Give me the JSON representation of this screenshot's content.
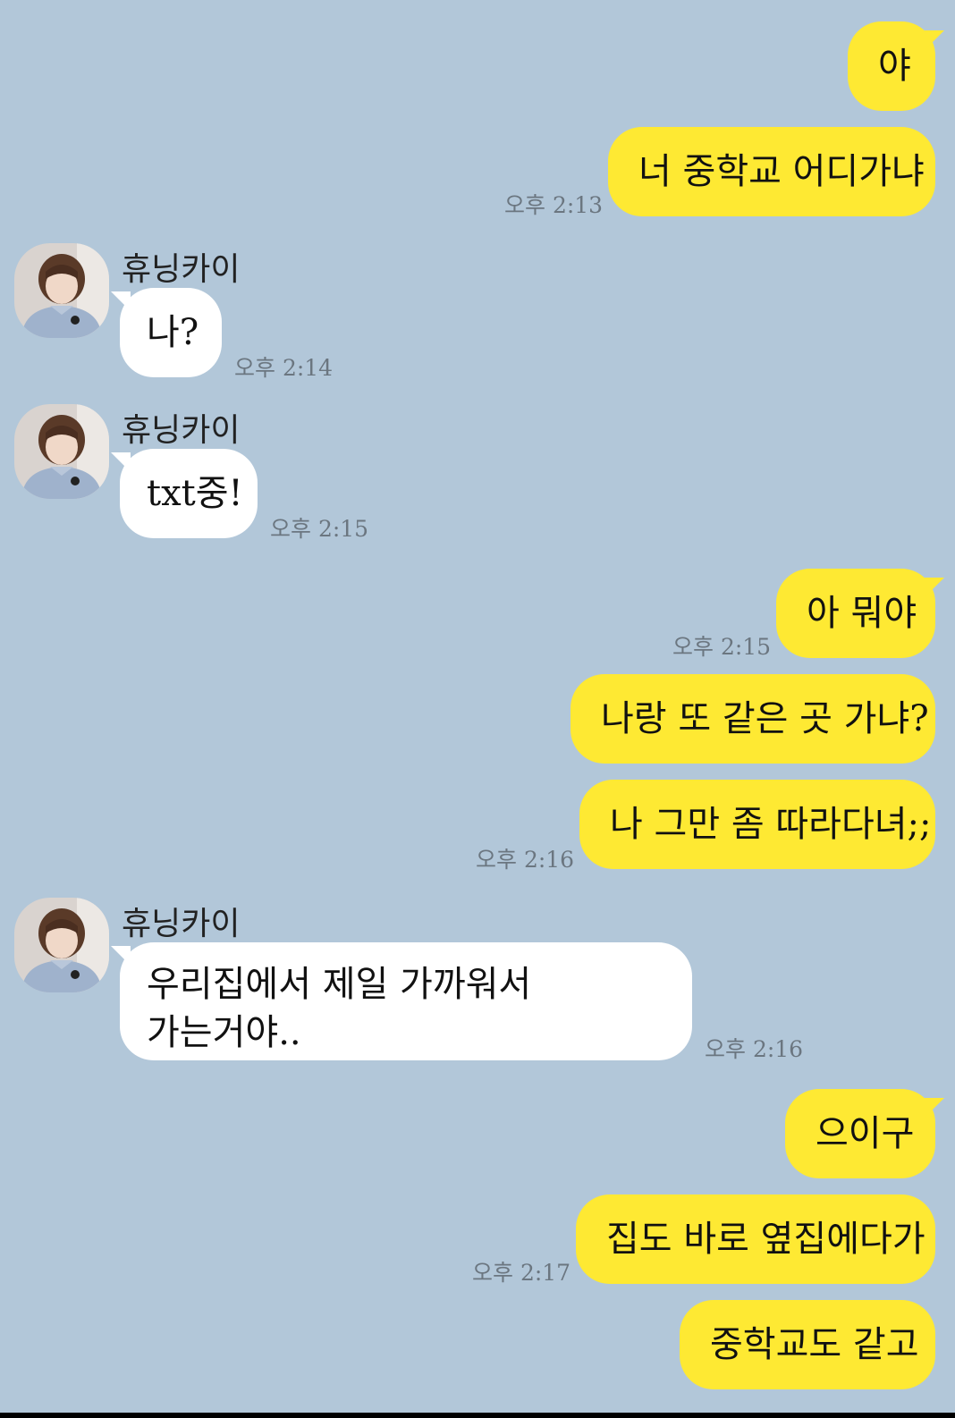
{
  "chat": {
    "sender_name": "휴닝카이",
    "messages": [
      {
        "from": "me",
        "text": "야"
      },
      {
        "from": "me",
        "text": "너 중학교 어디가냐",
        "time": "오후 2:13"
      },
      {
        "from": "them",
        "text": "나?",
        "time": "오후 2:14"
      },
      {
        "from": "them",
        "text": "txt중!",
        "time": "오후 2:15"
      },
      {
        "from": "me",
        "text": "아 뭐야",
        "time": "오후 2:15"
      },
      {
        "from": "me",
        "text": "나랑 또 같은 곳 가냐?"
      },
      {
        "from": "me",
        "text": "나 그만 좀 따라다녀;;",
        "time": "오후 2:16"
      },
      {
        "from": "them",
        "text": "우리집에서 제일 가까워서 가는거야..",
        "time": "오후 2:16"
      },
      {
        "from": "me",
        "text": "으이구"
      },
      {
        "from": "me",
        "text": "집도 바로 옆집에다가",
        "time": "오후 2:17"
      },
      {
        "from": "me",
        "text": "중학교도 같고"
      }
    ]
  },
  "colors": {
    "background": "#b2c7d9",
    "my_bubble": "#fee933",
    "their_bubble": "#ffffff",
    "timestamp": "#6b7680"
  },
  "icons": {
    "avatar": "profile-photo-avatar"
  }
}
